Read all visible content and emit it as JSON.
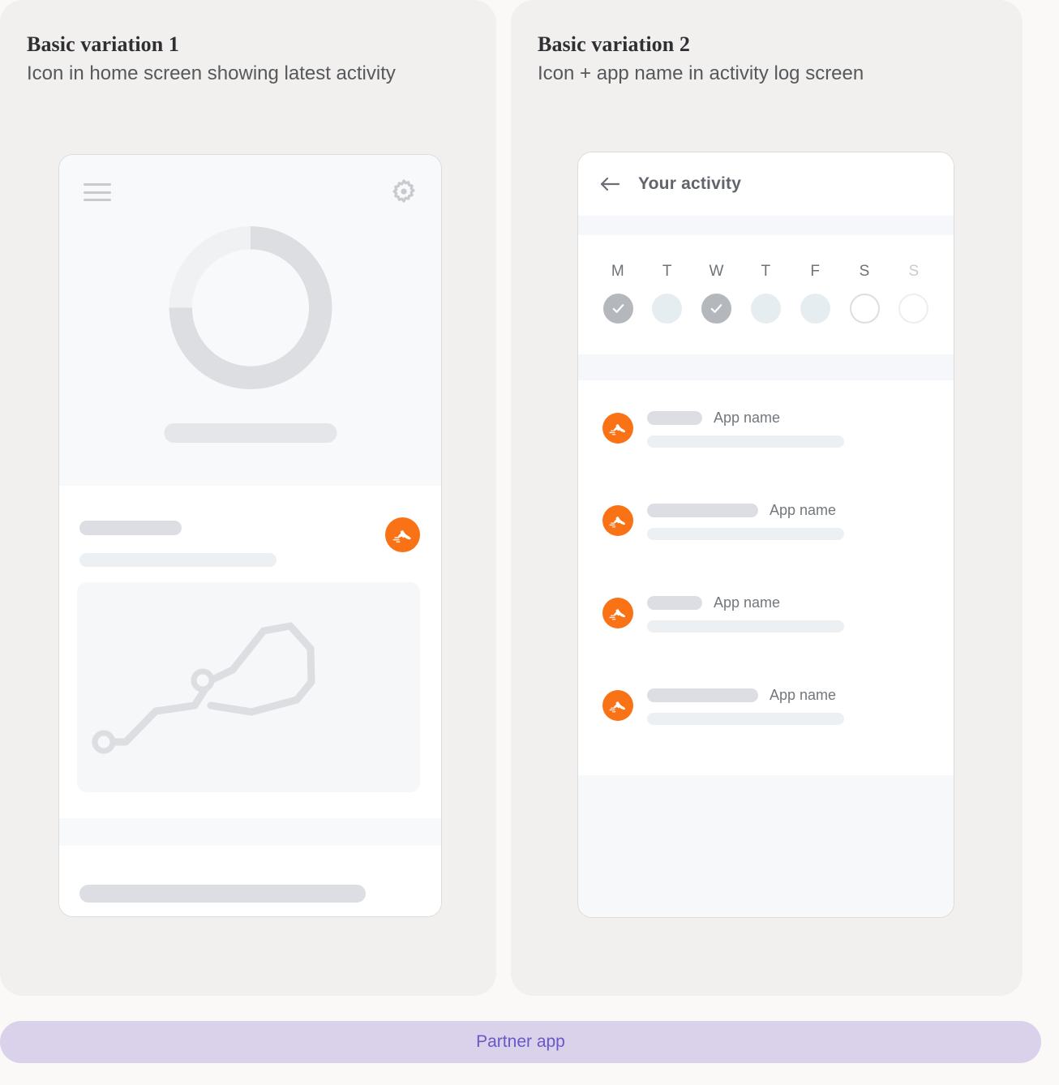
{
  "panels": [
    {
      "title": "Basic variation 1",
      "subtitle": "Icon in home screen showing latest activity",
      "icons": {
        "menu": "hamburger-menu-icon",
        "settings": "gear-icon",
        "partner": "running-shoe-icon",
        "map": "route-map-illustration"
      },
      "progress_ring": {
        "filled_percent": 75,
        "filled_color": "#DCDEE2",
        "track_color": "#EFF1F3"
      }
    },
    {
      "title": "Basic variation 2",
      "subtitle": "Icon + app name in activity log screen",
      "header": {
        "back_icon": "back-arrow-icon",
        "title": "Your activity"
      },
      "week": {
        "days": [
          {
            "label": "M",
            "state": "done"
          },
          {
            "label": "T",
            "state": "filled"
          },
          {
            "label": "W",
            "state": "done"
          },
          {
            "label": "T",
            "state": "filled"
          },
          {
            "label": "F",
            "state": "filled"
          },
          {
            "label": "S",
            "state": "empty"
          },
          {
            "label": "S",
            "state": "faint"
          }
        ]
      },
      "activities": [
        {
          "icon": "running-shoe-icon",
          "placeholder_width": 68,
          "app_name": "App name"
        },
        {
          "icon": "running-shoe-icon",
          "placeholder_width": 137,
          "app_name": "App name"
        },
        {
          "icon": "running-shoe-icon",
          "placeholder_width": 68,
          "app_name": "App name"
        },
        {
          "icon": "running-shoe-icon",
          "placeholder_width": 137,
          "app_name": "App name"
        }
      ]
    }
  ],
  "footer": {
    "label": "Partner app",
    "background": "#D9D2EA",
    "text_color": "#6A57C8"
  },
  "theme": {
    "page_background": "#FAF9F7",
    "panel_background": "#F1F0EE",
    "accent_orange": "#F97316"
  }
}
